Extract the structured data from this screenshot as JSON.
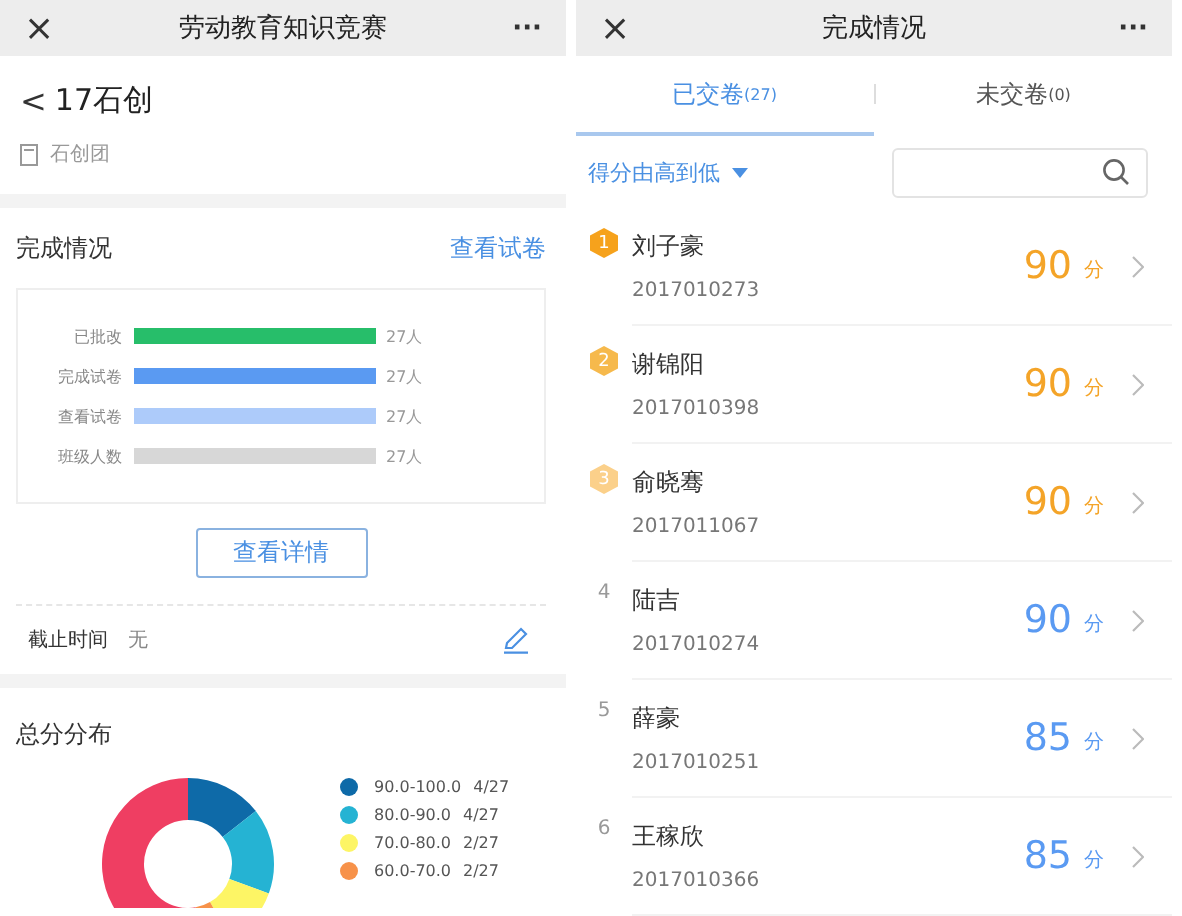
{
  "left_screen": {
    "nav_bar": {
      "close": "×",
      "title": "劳动教育知识竞赛",
      "more": "···"
    },
    "header": {
      "back": "<",
      "title": "17石创",
      "group": "石创团"
    },
    "completion": {
      "title": "完成情况",
      "link": "查看试卷",
      "rows": [
        {
          "label": "已批改",
          "reading": "27人",
          "color": "#27be6a"
        },
        {
          "label": "完成试卷",
          "reading": "27人",
          "color": "#5a9af2"
        },
        {
          "label": "查看试卷",
          "reading": "27人",
          "color": "#adcbfa"
        },
        {
          "label": "班级人数",
          "reading": "27人",
          "color": "#d7d7d7"
        }
      ],
      "button": "查看详情",
      "deadline_label": "截止时间",
      "deadline_value": "无"
    },
    "distribution": {
      "title": "总分分布",
      "legend": [
        {
          "range": "90.0-100.0",
          "count": "4/27",
          "color": "#0e6aa8"
        },
        {
          "range": "80.0-90.0",
          "count": "4/27",
          "color": "#25b3d3"
        },
        {
          "range": "70.0-80.0",
          "count": "2/27",
          "color": "#fdf565"
        },
        {
          "range": "60.0-70.0",
          "count": "2/27",
          "color": "#f7924a"
        }
      ]
    }
  },
  "right_screen": {
    "nav_bar": {
      "close": "×",
      "title": "完成情况",
      "more": "···"
    },
    "tabs": [
      {
        "label": "已交卷",
        "count": "(27)",
        "selected": true
      },
      {
        "label": "未交卷",
        "count": "(0)",
        "selected": false
      }
    ],
    "sort": {
      "label": "得分由高到低"
    },
    "students": [
      {
        "rank": "1",
        "kind": "medal",
        "color": "#f6a21c",
        "name": "刘子豪",
        "id": "2017010273",
        "score": "90",
        "unit": "分"
      },
      {
        "rank": "2",
        "kind": "medal",
        "color": "#f6b94c",
        "name": "谢锦阳",
        "id": "2017010398",
        "score": "90",
        "unit": "分"
      },
      {
        "rank": "3",
        "kind": "medal",
        "color": "#fbd08a",
        "name": "俞晓骞",
        "id": "2017011067",
        "score": "90",
        "unit": "分"
      },
      {
        "rank": "4",
        "kind": "plain",
        "name": "陆吉",
        "id": "2017010274",
        "score": "90",
        "unit": "分"
      },
      {
        "rank": "5",
        "kind": "plain",
        "name": "薛豪",
        "id": "2017010251",
        "score": "85",
        "unit": "分"
      },
      {
        "rank": "6",
        "kind": "plain",
        "name": "王稼欣",
        "id": "2017010366",
        "score": "85",
        "unit": "分"
      }
    ]
  }
}
